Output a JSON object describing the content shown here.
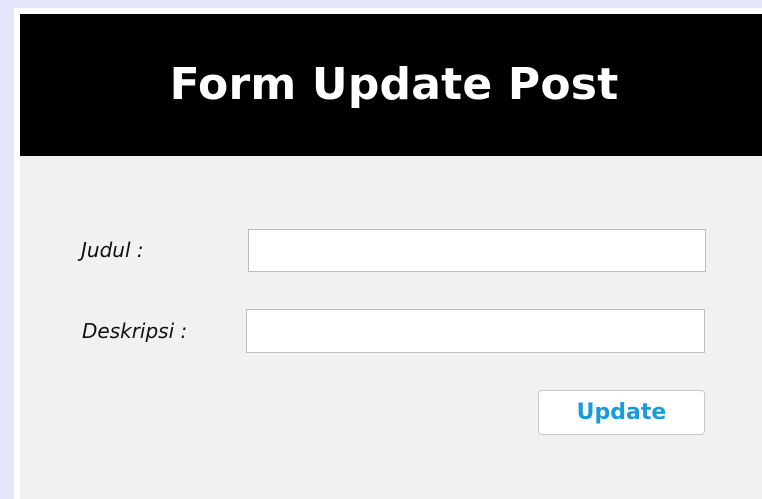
{
  "header": {
    "title": "Form Update Post"
  },
  "form": {
    "judul": {
      "label": "Judul :",
      "value": ""
    },
    "deskripsi": {
      "label": "Deskripsi :",
      "value": ""
    },
    "submit_label": "Update"
  },
  "colors": {
    "page_background": "#e4e4fb",
    "header_background": "#000000",
    "header_text": "#ffffff",
    "card_background": "#f1f1f1",
    "button_text": "#1a9cd8"
  }
}
